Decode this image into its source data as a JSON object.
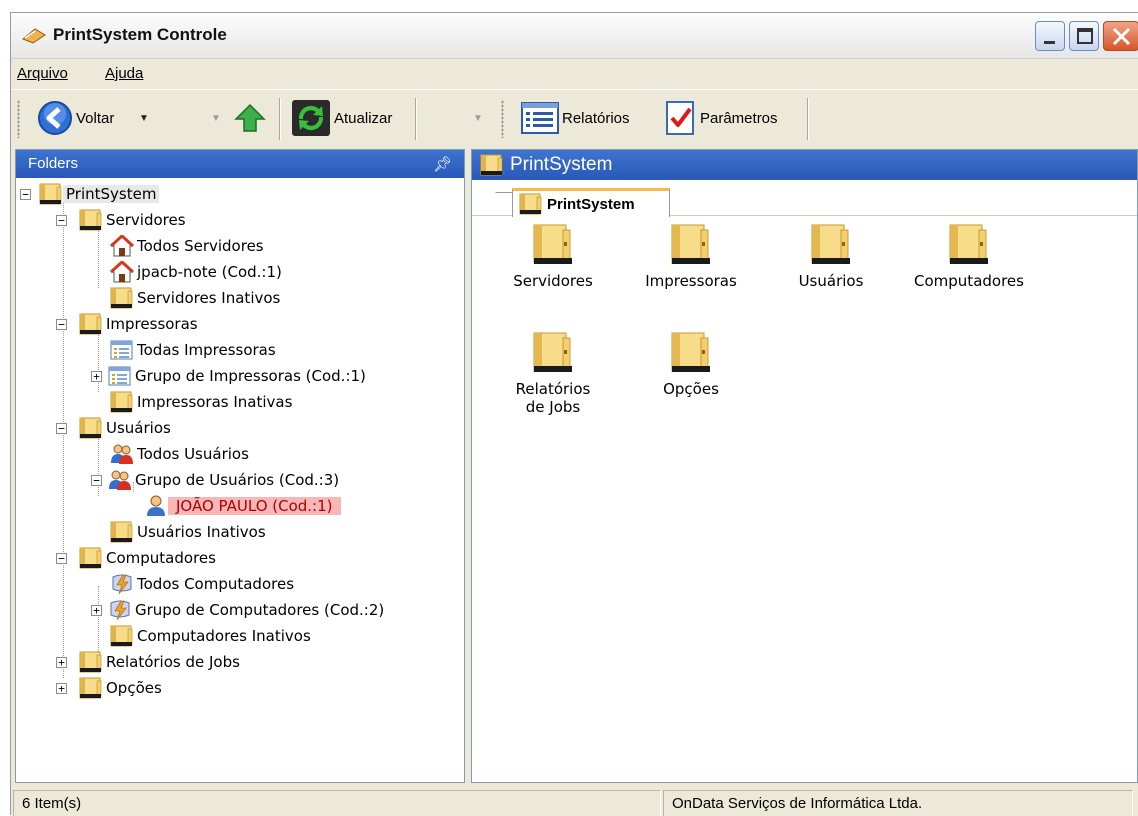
{
  "window": {
    "title": "PrintSystem Controle"
  },
  "menu": {
    "items": [
      {
        "label": "Arquivo"
      },
      {
        "label": "Ajuda"
      }
    ]
  },
  "toolbar": {
    "back_label": "Voltar",
    "refresh_label": "Atualizar",
    "reports_label": "Relatórios",
    "params_label": "Parâmetros"
  },
  "folders": {
    "header": "Folders",
    "tree": [
      {
        "label": "PrintSystem",
        "icon": "folder-icon"
      },
      {
        "label": "Servidores",
        "icon": "folder-icon"
      },
      {
        "label": "Todos Servidores",
        "icon": "server-house-icon"
      },
      {
        "label": "jpacb-note (Cod.:1)",
        "icon": "server-house-icon"
      },
      {
        "label": "Servidores Inativos",
        "icon": "folder-icon"
      },
      {
        "label": "Impressoras",
        "icon": "folder-icon"
      },
      {
        "label": "Todas Impressoras",
        "icon": "list-icon"
      },
      {
        "label": "Grupo de Impressoras (Cod.:1)",
        "icon": "list-icon"
      },
      {
        "label": "Impressoras Inativas",
        "icon": "folder-icon"
      },
      {
        "label": "Usuários",
        "icon": "folder-icon"
      },
      {
        "label": "Todos Usuários",
        "icon": "users-icon"
      },
      {
        "label": "Grupo de Usuários (Cod.:3)",
        "icon": "users-icon"
      },
      {
        "label": "JOÃO PAULO (Cod.:1)",
        "icon": "user-icon"
      },
      {
        "label": "Usuários Inativos",
        "icon": "folder-icon"
      },
      {
        "label": "Computadores",
        "icon": "folder-icon"
      },
      {
        "label": "Todos Computadores",
        "icon": "computer-icon"
      },
      {
        "label": "Grupo de Computadores (Cod.:2)",
        "icon": "computer-icon"
      },
      {
        "label": "Computadores Inativos",
        "icon": "folder-icon"
      },
      {
        "label": "Relatórios de Jobs",
        "icon": "folder-icon"
      },
      {
        "label": "Opções",
        "icon": "folder-icon"
      }
    ]
  },
  "content": {
    "header": "PrintSystem",
    "tab_label": "PrintSystem",
    "items": [
      {
        "label": "Servidores"
      },
      {
        "label": "Impressoras"
      },
      {
        "label": "Usuários"
      },
      {
        "label": "Computadores"
      },
      {
        "label": "Relatórios de Jobs"
      },
      {
        "label": "Opções"
      }
    ]
  },
  "status": {
    "count": "6 Item(s)",
    "company": "OnData Serviços de Informática Ltda."
  },
  "colors": {
    "header_blue": "#2a58b8",
    "selection": "#f7b7b7",
    "folder": "#f3d37a"
  }
}
